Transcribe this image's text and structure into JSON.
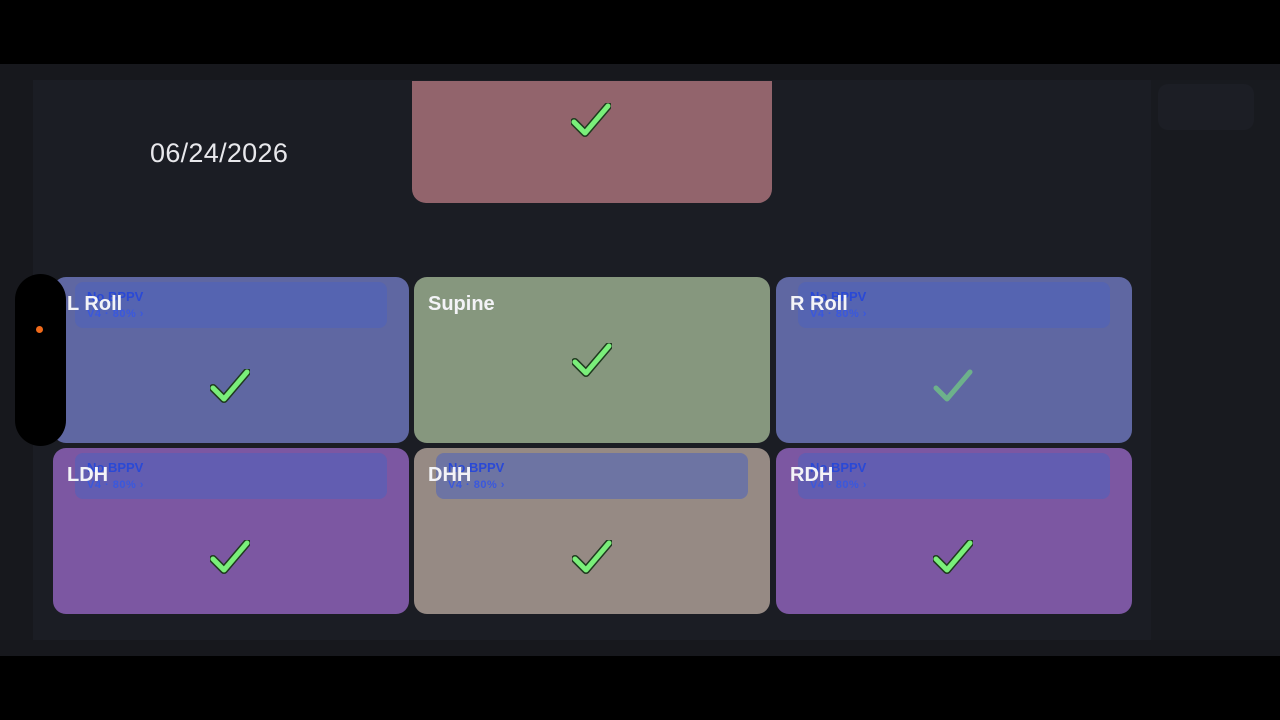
{
  "date": "06/24/2026",
  "top_tile": {
    "color": "#92646c",
    "checked": true
  },
  "toolbar": {
    "ghost_label": ""
  },
  "colors": {
    "roll": "#5f67a2",
    "supine": "#86977e",
    "dh": "#7c57a2",
    "dhh": "#968a84",
    "check": "#7aef7a"
  },
  "tiles": [
    {
      "label": "L Roll",
      "checked": true,
      "overlay": {
        "title": "No BPPV",
        "sub": "V4 · 80% ›"
      }
    },
    {
      "label": "Supine",
      "checked": true
    },
    {
      "label": "R Roll",
      "checked": true,
      "overlay": {
        "title": "No BPPV",
        "sub": "V4 · 80% ›"
      }
    },
    {
      "label": "LDH",
      "checked": true,
      "overlay": {
        "title": "No BPPV",
        "sub": "V4 · 80% ›"
      }
    },
    {
      "label": "DHH",
      "checked": true,
      "overlay": {
        "title": "No BPPV",
        "sub": "V4 · 80% ›"
      }
    },
    {
      "label": "RDH",
      "checked": true,
      "overlay": {
        "title": "No BPPV",
        "sub": "V4 · 80% ›"
      }
    }
  ]
}
